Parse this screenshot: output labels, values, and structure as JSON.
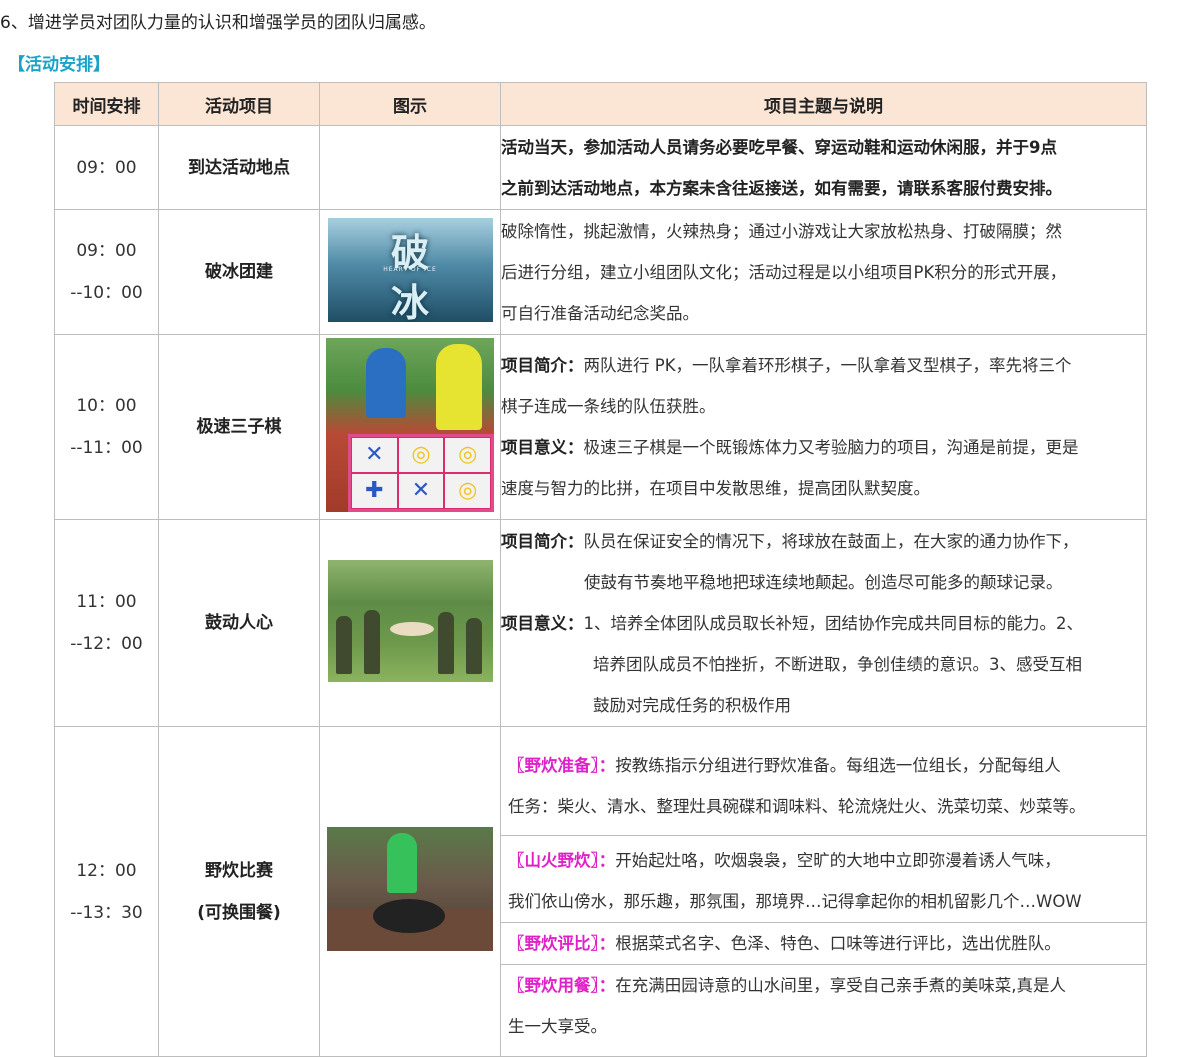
{
  "intro": "6、增进学员对团队力量的认识和增强学员的团队归属感。",
  "section_title": "【活动安排】",
  "table": {
    "headers": [
      "时间安排",
      "活动项目",
      "图示",
      "项目主题与说明"
    ],
    "rows": [
      {
        "time_start": "09：00",
        "time_end": "",
        "activity": "到达活动地点",
        "activity_sub": "",
        "desc_lines": [
          "活动当天，参加活动人员请务必要吃早餐、穿运动鞋和运动休闲服，并于9点",
          "之前到达活动地点，本方案未含往返接送，如有需要，请联系客服付费安排。"
        ]
      },
      {
        "time_start": "09：00",
        "time_end": "--10：00",
        "activity": "破冰团建",
        "image_chars": [
          "破",
          "冰"
        ],
        "image_caption": "HEART OF ICE",
        "desc_lines": [
          "破除惰性，挑起激情，火辣热身；通过小游戏让大家放松热身、打破隔膜；然",
          "后进行分组，建立小组团队文化；活动过程是以小组项目PK积分的形式开展，",
          "可自行准备活动纪念奖品。"
        ]
      },
      {
        "time_start": "10：00",
        "time_end": "--11：00",
        "activity": "极速三子棋",
        "intro_label": "项目简介：",
        "intro_lines": [
          "两队进行 PK，一队拿着环形棋子，一队拿着叉型棋子，率先将三个",
          "棋子连成一条线的队伍获胜。"
        ],
        "meaning_label": "项目意义：",
        "meaning_lines": [
          "极速三子棋是一个既锻炼体力又考验脑力的项目，沟通是前提，更是",
          "速度与智力的比拼，在项目中发散思维，提高团队默契度。"
        ]
      },
      {
        "time_start": "11：00",
        "time_end": "--12：00",
        "activity": "鼓动人心",
        "intro_label": "项目简介：",
        "intro_lines": [
          "队员在保证安全的情况下，将球放在鼓面上，在大家的通力协作下，",
          "使鼓有节奏地平稳地把球连续地颠起。创造尽可能多的颠球记录。"
        ],
        "meaning_label": "项目意义：",
        "meaning_lines": [
          "1、培养全体团队成员取长补短，团结协作完成共同目标的能力。2、",
          "培养团队成员不怕挫折，不断进取，争创佳绩的意识。3、感受互相",
          "鼓励对完成任务的积极作用"
        ]
      },
      {
        "time_start": "12：00",
        "time_end": "--13：30",
        "activity": "野炊比赛",
        "activity_sub": "(可换围餐)",
        "subs": [
          {
            "tag": "〖野炊准备〗：",
            "lines": [
              "按教练指示分组进行野炊准备。每组选一位组长，分配每组人",
              "任务：柴火、清水、整理灶具碗碟和调味料、轮流烧灶火、洗菜切菜、炒菜等。"
            ]
          },
          {
            "tag": "〖山火野炊〗：",
            "lines": [
              "开始起灶咯，吹烟袅袅，空旷的大地中立即弥漫着诱人气味，",
              "我们依山傍水，那乐趣，那氛围，那境界…记得拿起你的相机留影几个…WOW"
            ]
          },
          {
            "tag": "〖野炊评比〗：",
            "lines": [
              "根据菜式名字、色泽、特色、口味等进行评比，选出优胜队。"
            ]
          },
          {
            "tag": "〖野炊用餐〗：",
            "lines": [
              "在充满田园诗意的山水间里，享受自己亲手煮的美味菜,真是人",
              "生一大享受。"
            ]
          }
        ]
      }
    ]
  },
  "colors": {
    "header_bg": "#fbe6d6",
    "section_title": "#1aa3c8",
    "tag": "#e020c8",
    "border": "#bdbdbd"
  }
}
